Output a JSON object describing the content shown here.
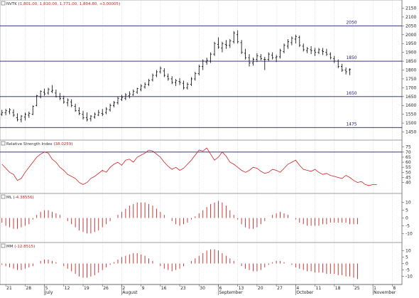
{
  "chart_data": [
    {
      "type": "ohlc",
      "title": "NVTK (1,801.00, 1,810.00, 1,771.00, 1,804.80, +3.00005)",
      "ylim": [
        1420,
        2180
      ],
      "yticks": [
        1450,
        1500,
        1550,
        1600,
        1650,
        1700,
        1750,
        1800,
        1850,
        1900,
        1950,
        2000,
        2050,
        2100,
        2150
      ],
      "hlines": [
        {
          "value": 2050,
          "label": "2050"
        },
        {
          "value": 1850,
          "label": "1850"
        },
        {
          "value": 1650,
          "label": "1650"
        },
        {
          "value": 1475,
          "label": "1475"
        }
      ],
      "candles": [
        [
          1550,
          1575,
          1540,
          1560
        ],
        [
          1558,
          1580,
          1545,
          1570
        ],
        [
          1565,
          1585,
          1550,
          1575
        ],
        [
          1560,
          1578,
          1535,
          1545
        ],
        [
          1530,
          1555,
          1510,
          1520
        ],
        [
          1520,
          1545,
          1505,
          1540
        ],
        [
          1535,
          1560,
          1515,
          1550
        ],
        [
          1545,
          1565,
          1530,
          1555
        ],
        [
          1550,
          1600,
          1545,
          1595
        ],
        [
          1600,
          1660,
          1595,
          1655
        ],
        [
          1650,
          1685,
          1640,
          1680
        ],
        [
          1675,
          1695,
          1655,
          1665
        ],
        [
          1670,
          1700,
          1660,
          1690
        ],
        [
          1680,
          1715,
          1670,
          1685
        ],
        [
          1670,
          1690,
          1645,
          1650
        ],
        [
          1650,
          1670,
          1630,
          1640
        ],
        [
          1640,
          1655,
          1610,
          1620
        ],
        [
          1615,
          1640,
          1595,
          1630
        ],
        [
          1620,
          1635,
          1590,
          1600
        ],
        [
          1595,
          1610,
          1565,
          1570
        ],
        [
          1570,
          1590,
          1545,
          1555
        ],
        [
          1550,
          1570,
          1520,
          1530
        ],
        [
          1530,
          1560,
          1510,
          1520
        ],
        [
          1525,
          1545,
          1510,
          1540
        ],
        [
          1535,
          1560,
          1525,
          1550
        ],
        [
          1545,
          1575,
          1540,
          1560
        ],
        [
          1555,
          1580,
          1540,
          1550
        ],
        [
          1560,
          1590,
          1550,
          1580
        ],
        [
          1575,
          1610,
          1565,
          1600
        ],
        [
          1600,
          1625,
          1590,
          1615
        ],
        [
          1615,
          1650,
          1605,
          1640
        ],
        [
          1635,
          1660,
          1625,
          1645
        ],
        [
          1640,
          1670,
          1630,
          1660
        ],
        [
          1655,
          1680,
          1640,
          1665
        ],
        [
          1660,
          1690,
          1655,
          1680
        ],
        [
          1675,
          1700,
          1665,
          1695
        ],
        [
          1690,
          1720,
          1680,
          1710
        ],
        [
          1705,
          1730,
          1695,
          1720
        ],
        [
          1720,
          1750,
          1710,
          1740
        ],
        [
          1745,
          1780,
          1735,
          1770
        ],
        [
          1770,
          1800,
          1760,
          1790
        ],
        [
          1790,
          1820,
          1780,
          1810
        ],
        [
          1795,
          1810,
          1760,
          1770
        ],
        [
          1765,
          1780,
          1740,
          1750
        ],
        [
          1750,
          1765,
          1720,
          1730
        ],
        [
          1730,
          1750,
          1710,
          1740
        ],
        [
          1735,
          1755,
          1715,
          1730
        ],
        [
          1725,
          1740,
          1690,
          1700
        ],
        [
          1700,
          1730,
          1690,
          1720
        ],
        [
          1720,
          1760,
          1710,
          1750
        ],
        [
          1750,
          1790,
          1740,
          1780
        ],
        [
          1780,
          1830,
          1770,
          1820
        ],
        [
          1820,
          1860,
          1800,
          1850
        ],
        [
          1845,
          1870,
          1830,
          1855
        ],
        [
          1850,
          1900,
          1840,
          1890
        ],
        [
          1890,
          1960,
          1880,
          1950
        ],
        [
          1945,
          1985,
          1920,
          1930
        ],
        [
          1925,
          1960,
          1900,
          1950
        ],
        [
          1945,
          1970,
          1920,
          1940
        ],
        [
          1940,
          1975,
          1925,
          1965
        ],
        [
          1960,
          2020,
          1950,
          2010
        ],
        [
          2000,
          2025,
          1950,
          1960
        ],
        [
          1955,
          1970,
          1890,
          1900
        ],
        [
          1895,
          1920,
          1860,
          1870
        ],
        [
          1870,
          1890,
          1820,
          1840
        ],
        [
          1840,
          1870,
          1825,
          1860
        ],
        [
          1860,
          1895,
          1845,
          1880
        ],
        [
          1875,
          1890,
          1855,
          1865
        ],
        [
          1860,
          1875,
          1800,
          1860
        ],
        [
          1860,
          1900,
          1850,
          1890
        ],
        [
          1885,
          1900,
          1860,
          1870
        ],
        [
          1870,
          1885,
          1845,
          1875
        ],
        [
          1875,
          1920,
          1865,
          1910
        ],
        [
          1905,
          1950,
          1895,
          1940
        ],
        [
          1935,
          1975,
          1920,
          1960
        ],
        [
          1955,
          1990,
          1940,
          1980
        ],
        [
          1975,
          2000,
          1950,
          1990
        ],
        [
          1985,
          1995,
          1930,
          1940
        ],
        [
          1935,
          1950,
          1905,
          1915
        ],
        [
          1910,
          1930,
          1895,
          1920
        ],
        [
          1915,
          1935,
          1890,
          1910
        ],
        [
          1910,
          1925,
          1880,
          1900
        ],
        [
          1900,
          1925,
          1890,
          1915
        ],
        [
          1910,
          1925,
          1885,
          1905
        ],
        [
          1900,
          1920,
          1880,
          1890
        ],
        [
          1890,
          1900,
          1860,
          1870
        ],
        [
          1865,
          1880,
          1840,
          1850
        ],
        [
          1850,
          1860,
          1810,
          1820
        ],
        [
          1820,
          1835,
          1790,
          1800
        ],
        [
          1800,
          1815,
          1775,
          1790
        ],
        [
          1801,
          1810,
          1771,
          1804.8
        ]
      ]
    },
    {
      "type": "line",
      "title": "Relative Strength Index (38.0259)",
      "ylim": [
        32,
        79
      ],
      "yticks": [
        40,
        45,
        50,
        55,
        60,
        65,
        70,
        75
      ],
      "hlines": [
        70
      ],
      "values": [
        58,
        54,
        50,
        48,
        42,
        44,
        50,
        55,
        60,
        65,
        68,
        70,
        69,
        63,
        60,
        55,
        52,
        48,
        46,
        44,
        40,
        38,
        40,
        44,
        46,
        49,
        52,
        50,
        55,
        58,
        60,
        57,
        62,
        63,
        60,
        65,
        67,
        69,
        72,
        71,
        68,
        65,
        60,
        56,
        53,
        55,
        52,
        54,
        58,
        62,
        67,
        72,
        71,
        74,
        68,
        62,
        65,
        70,
        66,
        60,
        58,
        55,
        52,
        50,
        52,
        55,
        54,
        51,
        49,
        50,
        53,
        52,
        50,
        54,
        58,
        60,
        62,
        57,
        53,
        52,
        51,
        53,
        50,
        48,
        49,
        47,
        46,
        45,
        44,
        47,
        45,
        42,
        40,
        41,
        38,
        37,
        38,
        38
      ]
    },
    {
      "type": "bar",
      "title": "ML (-4.38556)",
      "ylim": [
        -14,
        14
      ],
      "yticks": [
        -10,
        -5,
        0,
        5,
        10
      ],
      "values": [
        -3,
        -5,
        -6,
        -7,
        -7,
        -6,
        -5,
        -4,
        -1,
        2,
        4,
        5,
        5,
        4,
        3,
        2,
        0,
        -2,
        -4,
        -6,
        -8,
        -9,
        -10,
        -10,
        -9,
        -8,
        -6,
        -4,
        -2,
        0,
        2,
        4,
        6,
        8,
        9,
        10,
        10,
        10,
        9,
        8,
        6,
        4,
        2,
        0,
        -2,
        -4,
        -5,
        -4,
        -3,
        -1,
        1,
        3,
        5,
        7,
        9,
        10,
        11,
        10,
        8,
        5,
        2,
        -1,
        -4,
        -6,
        -7,
        -7,
        -6,
        -4,
        -2,
        0,
        2,
        3,
        4,
        3,
        2,
        0,
        -1,
        -3,
        -4,
        -5,
        -5,
        -5,
        -5,
        -4,
        -4,
        -3,
        -3,
        -3,
        -3,
        -3,
        -4,
        -4,
        -4
      ]
    },
    {
      "type": "bar",
      "title": "MM (-12.8515)",
      "ylim": [
        -14,
        14
      ],
      "yticks": [
        -10,
        -5,
        0,
        5,
        10
      ],
      "values": [
        -1,
        -2,
        -3,
        -4,
        -5,
        -5,
        -4,
        -3,
        -2,
        0,
        2,
        3,
        3,
        2,
        1,
        0,
        -2,
        -4,
        -6,
        -8,
        -10,
        -11,
        -11,
        -10,
        -9,
        -7,
        -5,
        -3,
        -1,
        1,
        3,
        5,
        6,
        7,
        8,
        8,
        7,
        6,
        4,
        2,
        0,
        -2,
        -4,
        -5,
        -6,
        -5,
        -4,
        -2,
        0,
        2,
        4,
        6,
        8,
        10,
        11,
        11,
        10,
        8,
        6,
        4,
        2,
        0,
        -2,
        -4,
        -5,
        -6,
        -6,
        -5,
        -3,
        -1,
        1,
        2,
        2,
        1,
        0,
        -1,
        -3,
        -4,
        -5,
        -6,
        -6,
        -7,
        -7,
        -7,
        -8,
        -8,
        -8,
        -9,
        -9,
        -10,
        -10,
        -11,
        -12
      ]
    }
  ],
  "x_axis": {
    "ticks": [
      {
        "i": 1,
        "label": "21"
      },
      {
        "i": 6,
        "label": "28"
      },
      {
        "i": 11,
        "label": "5"
      },
      {
        "i": 16,
        "label": "12"
      },
      {
        "i": 21,
        "label": "19"
      },
      {
        "i": 26,
        "label": "26"
      },
      {
        "i": 31,
        "label": "2"
      },
      {
        "i": 36,
        "label": "9"
      },
      {
        "i": 41,
        "label": "16"
      },
      {
        "i": 46,
        "label": "23"
      },
      {
        "i": 51,
        "label": "30"
      },
      {
        "i": 56,
        "label": "6"
      },
      {
        "i": 61,
        "label": "13"
      },
      {
        "i": 66,
        "label": "20"
      },
      {
        "i": 71,
        "label": "27"
      },
      {
        "i": 76,
        "label": "4"
      },
      {
        "i": 81,
        "label": "11"
      },
      {
        "i": 86,
        "label": "18"
      },
      {
        "i": 91,
        "label": "25"
      },
      {
        "i": 96,
        "label": "1"
      },
      {
        "i": 101,
        "label": "8"
      }
    ],
    "months": [
      {
        "i": 11,
        "label": "July"
      },
      {
        "i": 31,
        "label": "August"
      },
      {
        "i": 56,
        "label": "September"
      },
      {
        "i": 76,
        "label": "October"
      },
      {
        "i": 96,
        "label": "November"
      }
    ]
  },
  "colors": {
    "price": "#000000",
    "rsi": "#cc2222",
    "histogram": "#cc2222",
    "hline": "#1c1c6e",
    "title_value": "#cc2222"
  },
  "ui": {
    "pane_icon": "window-square-icon"
  }
}
